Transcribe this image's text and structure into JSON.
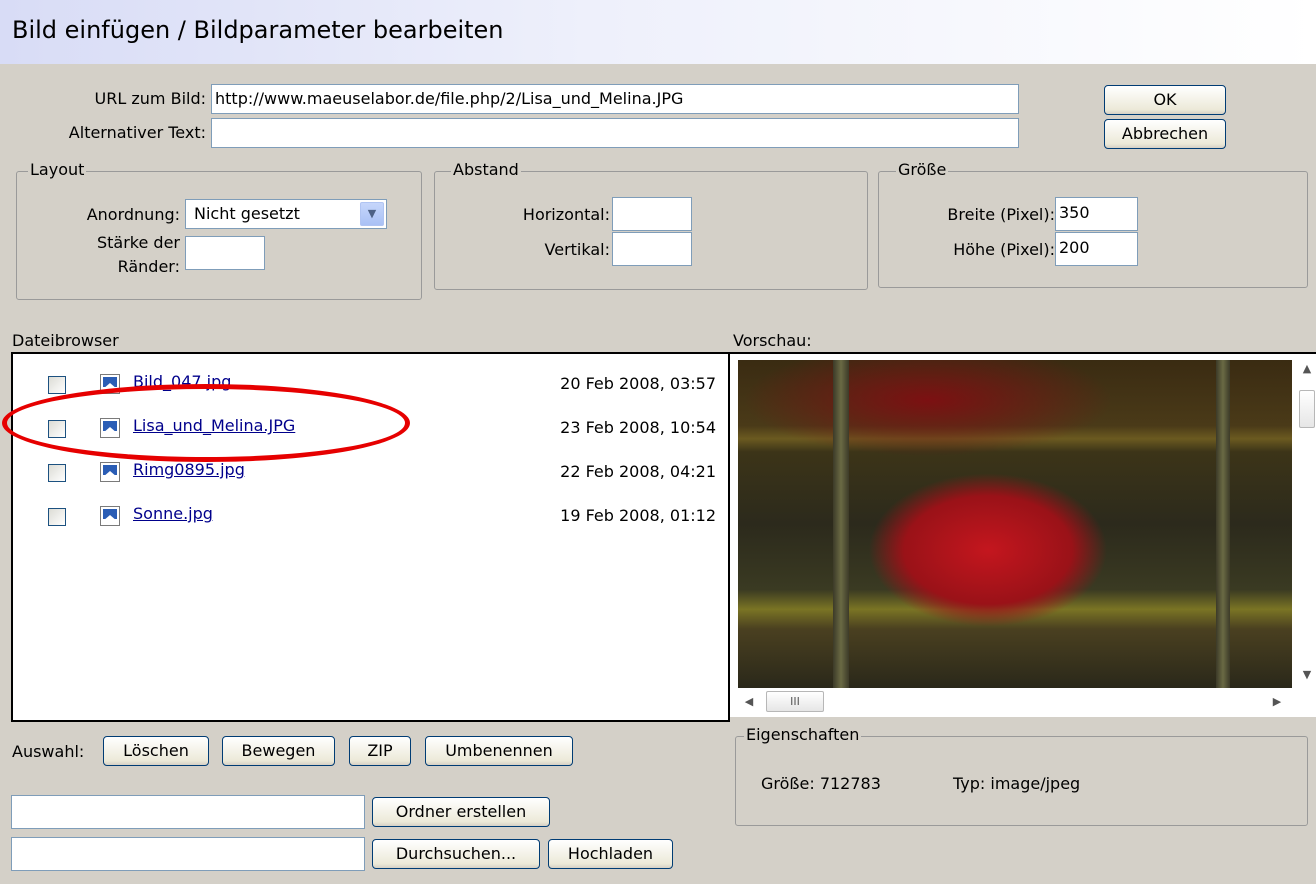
{
  "dialog": {
    "title": "Bild einfügen / Bildparameter bearbeiten"
  },
  "fields": {
    "url_label": "URL zum Bild:",
    "url_value": "http://www.maeuselabor.de/file.php/2/Lisa_und_Melina.JPG",
    "alt_label": "Alternativer Text:",
    "alt_value": ""
  },
  "buttons": {
    "ok": "OK",
    "cancel": "Abbrechen"
  },
  "layout": {
    "legend": "Layout",
    "anordnung_label": "Anordnung:",
    "anordnung_value": "Nicht gesetzt",
    "staerke_label_line1": "Stärke der",
    "staerke_label_line2": "Ränder:",
    "staerke_value": ""
  },
  "abstand": {
    "legend": "Abstand",
    "horizontal_label": "Horizontal:",
    "horizontal_value": "",
    "vertikal_label": "Vertikal:",
    "vertikal_value": ""
  },
  "groesse": {
    "legend": "Größe",
    "breite_label": "Breite (Pixel):",
    "breite_value": "350",
    "hoehe_label": "Höhe (Pixel):",
    "hoehe_value": "200"
  },
  "filebrowser": {
    "label": "Dateibrowser",
    "files": [
      {
        "name": "Bild_047.jpg",
        "date": "20 Feb 2008, 03:57"
      },
      {
        "name": "Lisa_und_Melina.JPG",
        "date": "23 Feb 2008, 10:54"
      },
      {
        "name": "Rimg0895.jpg",
        "date": "22 Feb 2008, 04:21"
      },
      {
        "name": "Sonne.jpg",
        "date": "19 Feb 2008, 01:12"
      }
    ]
  },
  "preview": {
    "label": "Vorschau:",
    "hscroll_grip": "III"
  },
  "eigenschaften": {
    "legend": "Eigenschaften",
    "size": "Größe: 712783",
    "type": "Typ: image/jpeg"
  },
  "selection": {
    "label": "Auswahl:",
    "delete": "Löschen",
    "move": "Bewegen",
    "zip": "ZIP",
    "rename": "Umbenennen"
  },
  "folder": {
    "input_value": "",
    "create_button": "Ordner erstellen"
  },
  "upload": {
    "input_value": "",
    "browse_button": "Durchsuchen...",
    "upload_button": "Hochladen"
  },
  "annotation": {
    "highlight_color": "#e60000"
  }
}
